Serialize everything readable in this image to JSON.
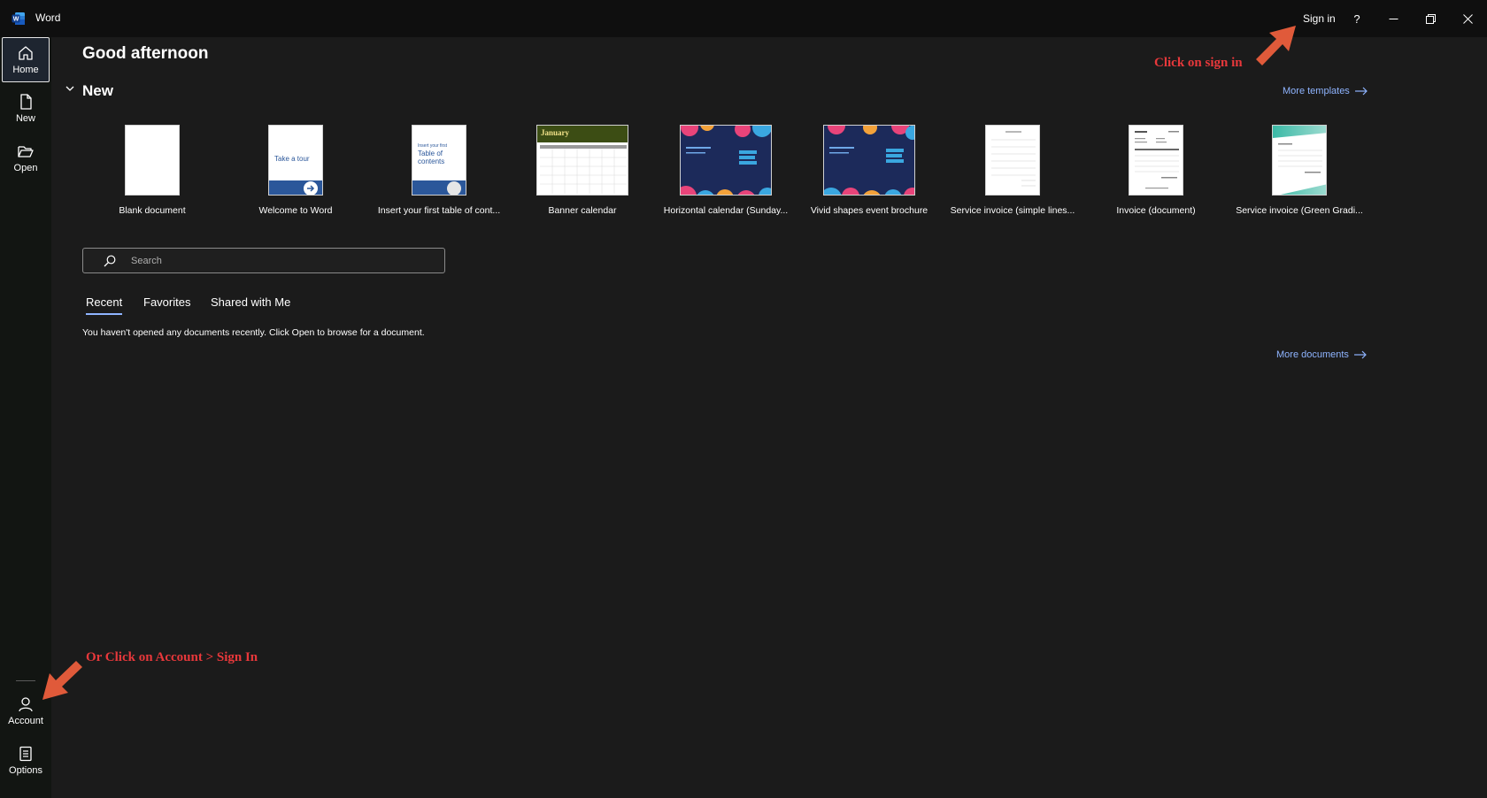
{
  "titlebar": {
    "app_name": "Word",
    "sign_in": "Sign in",
    "help": "?",
    "icons": [
      "word-logo-icon",
      "minimize-icon",
      "restore-icon",
      "close-icon"
    ]
  },
  "rail": {
    "items": [
      {
        "label": "Home",
        "icon": "home-icon"
      },
      {
        "label": "New",
        "icon": "new-document-icon"
      },
      {
        "label": "Open",
        "icon": "folder-open-icon"
      },
      {
        "label": "Account",
        "icon": "account-icon"
      },
      {
        "label": "Options",
        "icon": "options-icon"
      }
    ]
  },
  "main": {
    "greeting": "Good afternoon",
    "new_heading": "New",
    "more_templates": "More templates",
    "more_documents": "More documents",
    "templates": [
      {
        "label": "Blank document"
      },
      {
        "label": "Welcome to Word",
        "thumb_text": "Take a tour"
      },
      {
        "label": "Insert your first table of cont...",
        "thumb_small": "Insert your first",
        "thumb_big": "Table of contents"
      },
      {
        "label": "Banner calendar",
        "thumb_text": "January"
      },
      {
        "label": "Horizontal calendar (Sunday..."
      },
      {
        "label": "Vivid shapes event brochure"
      },
      {
        "label": "Service invoice (simple lines..."
      },
      {
        "label": "Invoice (document)"
      },
      {
        "label": "Service invoice (Green Gradi..."
      }
    ],
    "search_placeholder": "Search",
    "tabs": [
      "Recent",
      "Favorites",
      "Shared with Me"
    ],
    "active_tab": "Recent",
    "empty_message": "You haven't opened any documents recently. Click Open to browse for a document."
  },
  "annotations": {
    "top": "Click on sign in",
    "bottom": "Or Click on Account > Sign In",
    "color": "#e8383b"
  },
  "colors": {
    "background": "#1b1b1b",
    "titlebar": "#0f0f0f",
    "rail": "#121512",
    "link": "#8fb4ff",
    "word_blue": "#2b579a"
  }
}
